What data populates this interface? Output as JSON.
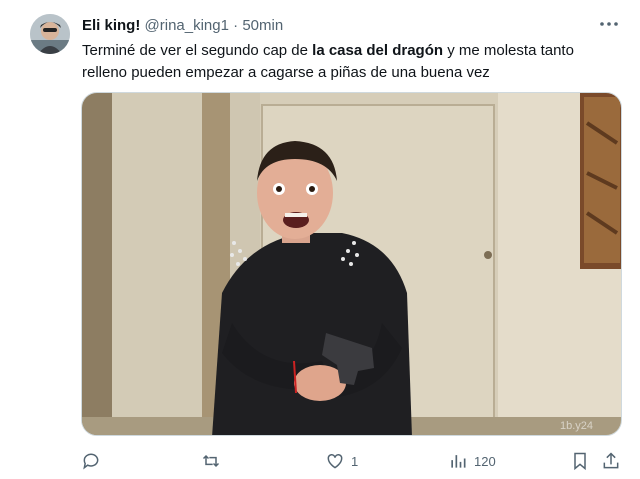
{
  "tweet": {
    "author_name": "Eli king!",
    "handle": "@rina_king1",
    "separator": "·",
    "time": "50min",
    "text_before": "Terminé de ver el segundo cap de ",
    "text_bold": "la casa del dragón",
    "text_after": " y me molesta tanto relleno pueden empezar a cagarse a piñas de una buena vez"
  },
  "media": {
    "watermark": "1b.y24"
  },
  "actions": {
    "reply_icon": "reply-icon",
    "retweet_icon": "retweet-icon",
    "like_icon": "heart-icon",
    "like_count": "1",
    "views_icon": "views-icon",
    "views_count": "120",
    "bookmark_icon": "bookmark-icon",
    "share_icon": "share-icon"
  },
  "colors": {
    "text": "#0f1419",
    "secondary": "#536471",
    "border": "#cfd9de"
  }
}
